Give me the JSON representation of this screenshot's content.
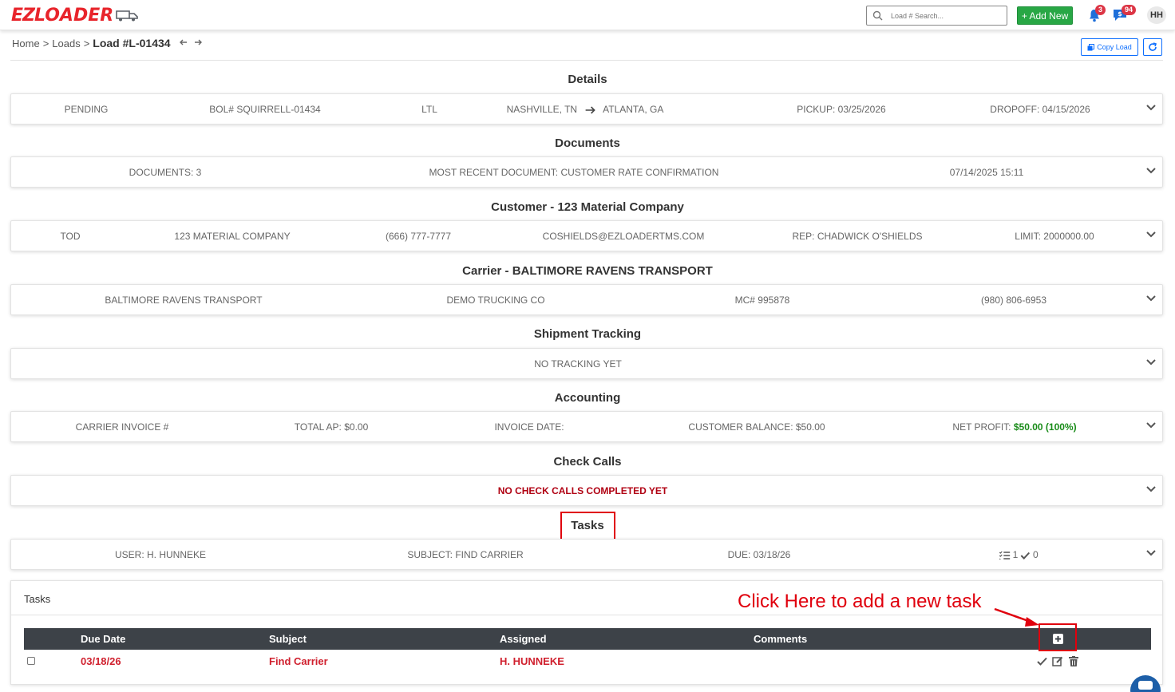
{
  "app": {
    "logo_ez": "EZ",
    "logo_loader": "LOADER",
    "search_placeholder": "Load # Search...",
    "add_new_label": "+ Add New",
    "notifications_count": "3",
    "messages_count": "94",
    "avatar_initials": "HH"
  },
  "breadcrumb": {
    "home": "Home",
    "sep1": ">",
    "loads": "Loads",
    "sep2": ">",
    "current": "Load #L-01434"
  },
  "actions": {
    "copy_load": "Copy Load"
  },
  "sections": {
    "details": {
      "title": "Details",
      "status": "PENDING",
      "bol": "BOL# SQUIRRELL-01434",
      "mode": "LTL",
      "origin": "NASHVILLE, TN",
      "destination": "ATLANTA, GA",
      "pickup": "PICKUP: 03/25/2026",
      "dropoff": "DROPOFF: 04/15/2026"
    },
    "documents": {
      "title": "Documents",
      "count": "DOCUMENTS: 3",
      "recent": "MOST RECENT DOCUMENT: CUSTOMER RATE CONFIRMATION",
      "timestamp": "07/14/2025 15:11"
    },
    "customer": {
      "title": "Customer - 123 Material Company",
      "terms": "TOD",
      "name": "123 MATERIAL COMPANY",
      "phone": "(666) 777-7777",
      "email": "COSHIELDS@EZLOADERTMS.COM",
      "rep": "REP: CHADWICK O'SHIELDS",
      "limit": "LIMIT: 2000000.00"
    },
    "carrier": {
      "title": "Carrier - BALTIMORE RAVENS TRANSPORT",
      "name": "BALTIMORE RAVENS TRANSPORT",
      "dba": "DEMO TRUCKING CO",
      "mc": "MC# 995878",
      "phone": "(980) 806-6953"
    },
    "tracking": {
      "title": "Shipment Tracking",
      "status": "NO TRACKING YET"
    },
    "accounting": {
      "title": "Accounting",
      "carrier_invoice": "CARRIER INVOICE #",
      "total_ap": "TOTAL AP: $0.00",
      "invoice_date": "INVOICE DATE:",
      "customer_balance": "CUSTOMER BALANCE: $50.00",
      "net_profit_label": "NET PROFIT:",
      "net_profit_value": "$50.00 (100%)"
    },
    "check_calls": {
      "title": "Check Calls",
      "status": "NO CHECK CALLS COMPLETED YET"
    },
    "tasks_summary": {
      "title": "Tasks",
      "user": "USER: H. HUNNEKE",
      "subject": "SUBJECT: FIND CARRIER",
      "due": "DUE: 03/18/26",
      "open_count": "1",
      "done_count": "0"
    }
  },
  "tasks_panel": {
    "title": "Tasks",
    "columns": [
      "Due Date",
      "Subject",
      "Assigned",
      "Comments"
    ],
    "rows": [
      {
        "due": "03/18/26",
        "subject": "Find Carrier",
        "assigned": "H. HUNNEKE",
        "comments": ""
      }
    ],
    "annotation": "Click Here to add a new task"
  },
  "colors": {
    "brand_red": "#e8242b",
    "accent_green": "#28a745",
    "primary_blue": "#0d6efd",
    "alert_red": "#b00012",
    "table_header": "#3d4248"
  }
}
